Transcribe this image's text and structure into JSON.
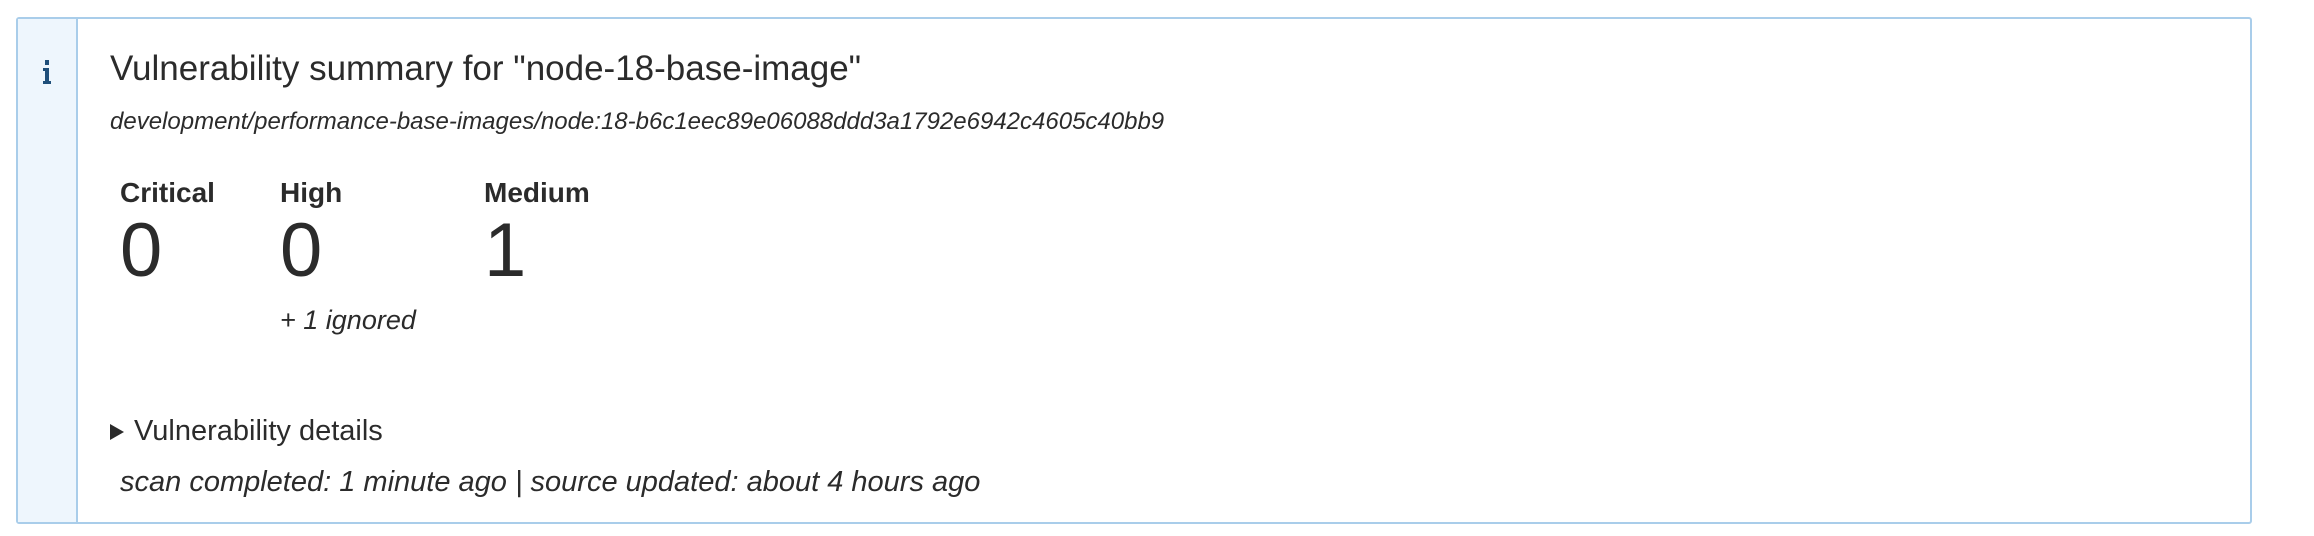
{
  "annotation": {
    "icon": "info-icon",
    "title": "Vulnerability summary for \"node-18-base-image\"",
    "image_ref": "development/performance-base-images/node:18-b6c1eec89e06088ddd3a1792e6942c4605c40bb9",
    "accent_color": "#a9cdea",
    "gutter_color": "#eef6fd"
  },
  "summary": {
    "critical": {
      "label": "Critical",
      "value": "0"
    },
    "high": {
      "label": "High",
      "value": "0",
      "note": "+ 1 ignored"
    },
    "medium": {
      "label": "Medium",
      "value": "1"
    }
  },
  "details": {
    "toggle_label": "Vulnerability details",
    "icon": "triangle-right-icon"
  },
  "status": {
    "text": "scan completed: 1 minute ago | source updated: about 4 hours ago"
  }
}
